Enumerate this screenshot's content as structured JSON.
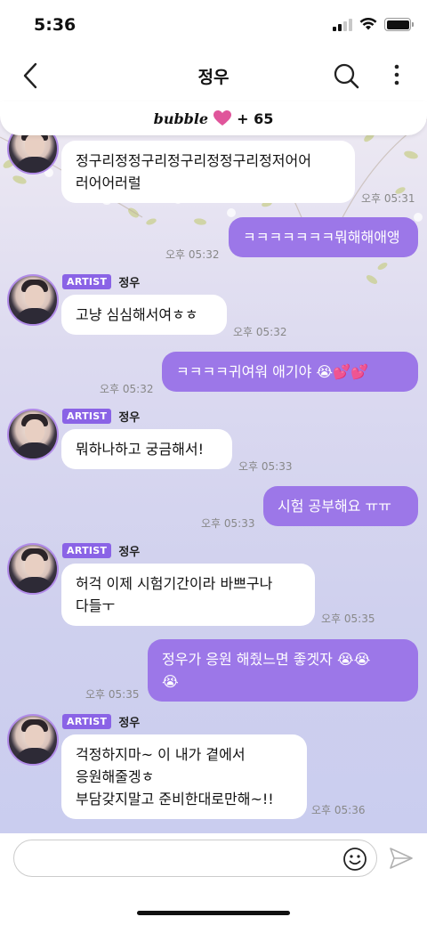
{
  "status": {
    "time": "5:36"
  },
  "header": {
    "title": "정우",
    "back_icon": "chevron-left-icon",
    "search_icon": "search-icon",
    "more_icon": "more-vertical-icon"
  },
  "bubble_bar": {
    "logo": "bubble",
    "heart_icon": "heart-icon",
    "count": "+ 65",
    "heart_color": "#e0559b"
  },
  "artist_badge": "ARTIST",
  "colors": {
    "outgoing_bubble": "#9c77e8",
    "badge": "#8a63e6",
    "incoming_bubble": "#ffffff"
  },
  "messages": [
    {
      "side": "in",
      "text": "정구리정정구리정구리정정구리정저어어\n러어어러럴",
      "time": "오후 05:31"
    },
    {
      "side": "out",
      "text": "ㅋㅋㅋㅋㅋㅋㅋ뭐해해애앵",
      "time": "오후 05:32"
    },
    {
      "side": "in",
      "name": "정우",
      "text": "고냥 심심해서여ㅎㅎ",
      "time": "오후 05:32"
    },
    {
      "side": "out",
      "text": "ㅋㅋㅋㅋ귀여워 애기야 😭💕💕",
      "time": "오후 05:32"
    },
    {
      "side": "in",
      "name": "정우",
      "text": "뭐하나하고 궁금해서!",
      "time": "오후 05:33"
    },
    {
      "side": "out",
      "text": "시험 공부해요 ㅠㅠ",
      "time": "오후 05:33"
    },
    {
      "side": "in",
      "name": "정우",
      "text": "허걱 이제 시험기간이라 바쁘구나\n다들ㅜ",
      "time": "오후 05:35"
    },
    {
      "side": "out",
      "text": "정우가 응원 해줬느면 좋겟자 😭😭\n😭",
      "time": "오후 05:35"
    },
    {
      "side": "in",
      "name": "정우",
      "text": "걱정하지마~ 이 내가 곁에서\n응원해줄겡ㅎ\n부담갖지말고 준비한대로만해~!!",
      "time": "오후 05:36"
    }
  ],
  "input": {
    "placeholder": "",
    "value": "",
    "emoji_icon": "smiley-icon",
    "send_icon": "send-icon"
  }
}
